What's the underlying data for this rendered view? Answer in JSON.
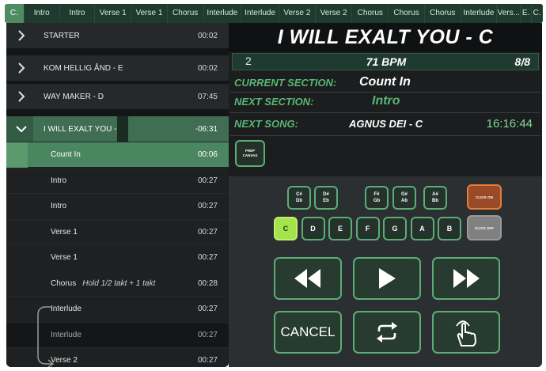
{
  "section_strip": [
    {
      "label": "C.",
      "width": 25,
      "active": true
    },
    {
      "label": "Intro",
      "width": 45
    },
    {
      "label": "Intro",
      "width": 45
    },
    {
      "label": "Verse 1",
      "width": 46
    },
    {
      "label": "Verse 1",
      "width": 46
    },
    {
      "label": "Chorus",
      "width": 46
    },
    {
      "label": "Interlude",
      "width": 48
    },
    {
      "label": "Interlude",
      "width": 48
    },
    {
      "label": "Verse 2",
      "width": 46
    },
    {
      "label": "Verse 2",
      "width": 47
    },
    {
      "label": "Chorus",
      "width": 46
    },
    {
      "label": "Chorus",
      "width": 46
    },
    {
      "label": "Chorus",
      "width": 46
    },
    {
      "label": "Interlude",
      "width": 46
    },
    {
      "label": "Vers...",
      "width": 30
    },
    {
      "label": "E.",
      "width": 14
    },
    {
      "label": "C.",
      "width": 14
    }
  ],
  "songs": [
    {
      "title": "STARTER",
      "time": "00:02"
    },
    {
      "title": "KOM HELLIG ÅND - E",
      "time": "00:02"
    },
    {
      "title": "WAY MAKER - D",
      "time": "07:45"
    }
  ],
  "open_song": {
    "title": "I WILL EXALT YOU - C",
    "time": "-06:31"
  },
  "sections": [
    {
      "label": "Count In",
      "time": "00:06",
      "state": "current",
      "note": ""
    },
    {
      "label": "Intro",
      "time": "00:27",
      "state": "",
      "note": ""
    },
    {
      "label": "Intro",
      "time": "00:27",
      "state": "",
      "note": ""
    },
    {
      "label": "Verse 1",
      "time": "00:27",
      "state": "",
      "note": ""
    },
    {
      "label": "Verse 1",
      "time": "00:27",
      "state": "",
      "note": ""
    },
    {
      "label": "Chorus",
      "time": "00:28",
      "state": "",
      "note": "Hold 1/2 takt + 1 takt"
    },
    {
      "label": "Interlude",
      "time": "00:27",
      "state": "",
      "note": ""
    },
    {
      "label": "Interlude",
      "time": "00:27",
      "state": "dim",
      "note": ""
    },
    {
      "label": "Verse 2",
      "time": "00:27",
      "state": "",
      "note": ""
    }
  ],
  "now_playing": {
    "title": "I WILL EXALT YOU - C",
    "bar": "2",
    "bpm": "71 BPM",
    "time_signature": "8/8",
    "current_section_label": "CURRENT SECTION:",
    "current_section": "Count In",
    "next_section_label": "NEXT SECTION:",
    "next_section": "Intro",
    "next_song_label": "NEXT SONG:",
    "next_song": "AGNUS DEI - C",
    "clock": "16:16:44"
  },
  "prep_canvas": {
    "line1": "PREP",
    "line2": "CANVAS"
  },
  "keys_sharp": [
    {
      "top": "C#",
      "bottom": "Db"
    },
    {
      "top": "D#",
      "bottom": "Eb"
    },
    {
      "top": "F#",
      "bottom": "Gb"
    },
    {
      "top": "G#",
      "bottom": "Ab"
    },
    {
      "top": "A#",
      "bottom": "Bb"
    }
  ],
  "keys_natural": [
    "C",
    "D",
    "E",
    "F",
    "G",
    "A",
    "B"
  ],
  "selected_key": "C",
  "click_on_label": "CLICK ON",
  "click_off_label": "CLICK OFF",
  "transport": {
    "cancel_label": "CANCEL",
    "rewind_icon": "rewind-icon",
    "play_icon": "play-icon",
    "forward_icon": "fast-forward-icon",
    "loop_icon": "loop-icon",
    "tap_icon": "tap-hand-icon"
  },
  "colors": {
    "accent_green": "#5aae74",
    "label_green": "#58b774",
    "selected_key": "#a5e34c",
    "click_on": "#9a4a26",
    "click_off": "#808080"
  }
}
